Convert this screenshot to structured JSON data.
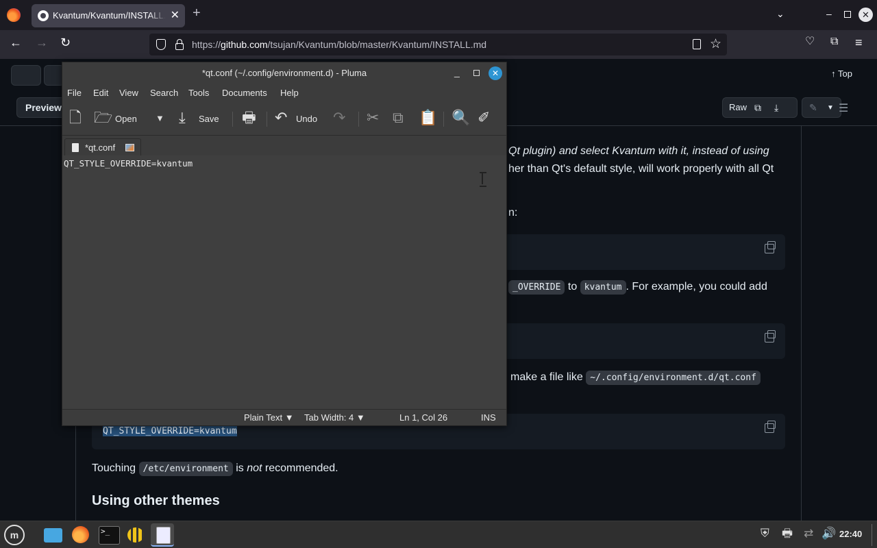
{
  "browser": {
    "tab_title": "Kvantum/Kvantum/INSTALL.md at master · tsujan/Kvantum",
    "tab_close": "✕",
    "new_tab": "+",
    "url_prefix": "https://",
    "url_host": "github.com",
    "url_path": "/tsujan/Kvantum/blob/master/Kvantum/INSTALL.md"
  },
  "github": {
    "top_label": "Top",
    "preview_label": "Preview",
    "raw_label": "Raw",
    "para1_line1": "Qt plugin) and select Kvantum with it, instead of using",
    "para1_line2": "her than Qt's default style, will work properly with all Qt",
    "para2_frag": "n:",
    "para3_code1": "_OVERRIDE",
    "para3_to": "to",
    "para3_code2": "kvantum",
    "para3_rest": ". For example, you could add",
    "para4_pre": "make a file like",
    "para4_code": "~/.config/environment.d/qt.conf",
    "code3": "QT_STYLE_OVERRIDE=kvantum",
    "touching_pre": "Touching",
    "touching_code": "/etc/environment",
    "touching_is": "is",
    "touching_not": "not",
    "touching_post": "recommended.",
    "heading": "Using other themes"
  },
  "pluma": {
    "title": "*qt.conf (~/.config/environment.d) - Pluma",
    "menus": [
      "File",
      "Edit",
      "View",
      "Search",
      "Tools",
      "Documents",
      "Help"
    ],
    "toolbar": {
      "open": "Open",
      "save": "Save",
      "undo": "Undo"
    },
    "tab_label": "*qt.conf",
    "content": "QT_STYLE_OVERRIDE=kvantum",
    "status": {
      "language": "Plain Text",
      "tab_width": "Tab Width:  4",
      "position": "Ln 1, Col 26",
      "mode": "INS"
    }
  },
  "taskbar": {
    "clock": "22:40"
  },
  "colors": {
    "github_bg": "#0d1117",
    "pluma_bg": "#3c3c3c",
    "pluma_close": "#2e95d3",
    "selection": "#264f78"
  }
}
